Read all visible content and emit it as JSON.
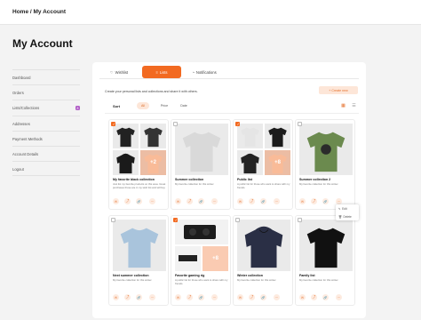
{
  "breadcrumb": "Home / My Account",
  "page_title": "My Account",
  "sidebar": {
    "items": [
      {
        "label": "Dashboard"
      },
      {
        "label": "Orders"
      },
      {
        "label": "Lists/Collections",
        "badge": "8"
      },
      {
        "label": "Addresses"
      },
      {
        "label": "Payment Methods"
      },
      {
        "label": "Account Details"
      },
      {
        "label": "Logout"
      }
    ]
  },
  "tabs": [
    {
      "label": "Wishlist",
      "icon": "heart-icon"
    },
    {
      "label": "Lists",
      "icon": "list-icon"
    },
    {
      "label": "Notifications",
      "icon": "bell-icon"
    }
  ],
  "description": "Create your personal lists and collections and share it with others.",
  "create_button": "+ Create new",
  "sort": {
    "label": "Sort",
    "options": [
      "All",
      "Price",
      "Date"
    ]
  },
  "cards": [
    {
      "name": "My favorite black collection",
      "desc": "Just list my favorite products on this area. Great purchases those are in my wish list and will buy.",
      "checked": true,
      "more": "+2"
    },
    {
      "name": "Summer collection",
      "desc": "My favorite collection for this winter.",
      "checked": false
    },
    {
      "name": "Public list",
      "desc": "A public list for those who want to share with my friends.",
      "checked": true,
      "more": "+8"
    },
    {
      "name": "Summer collection 2",
      "desc": "My favorite collection for this winter.",
      "checked": false
    },
    {
      "name": "Next summer collection",
      "desc": "My favorite collection for this winter.",
      "checked": false
    },
    {
      "name": "Favorite gaming rig",
      "desc": "A public list for those who want to share with my friends.",
      "checked": true,
      "more": "+8"
    },
    {
      "name": "Winter collection",
      "desc": "My favorite collection for this winter.",
      "checked": false
    },
    {
      "name": "Family list",
      "desc": "My favorite collection for this winter.",
      "checked": false
    }
  ],
  "context_menu": {
    "edit": "Edit",
    "delete": "Delete"
  },
  "colors": {
    "accent": "#f26a21",
    "accent_light": "#fde6d8",
    "badge": "#b05cc6"
  }
}
